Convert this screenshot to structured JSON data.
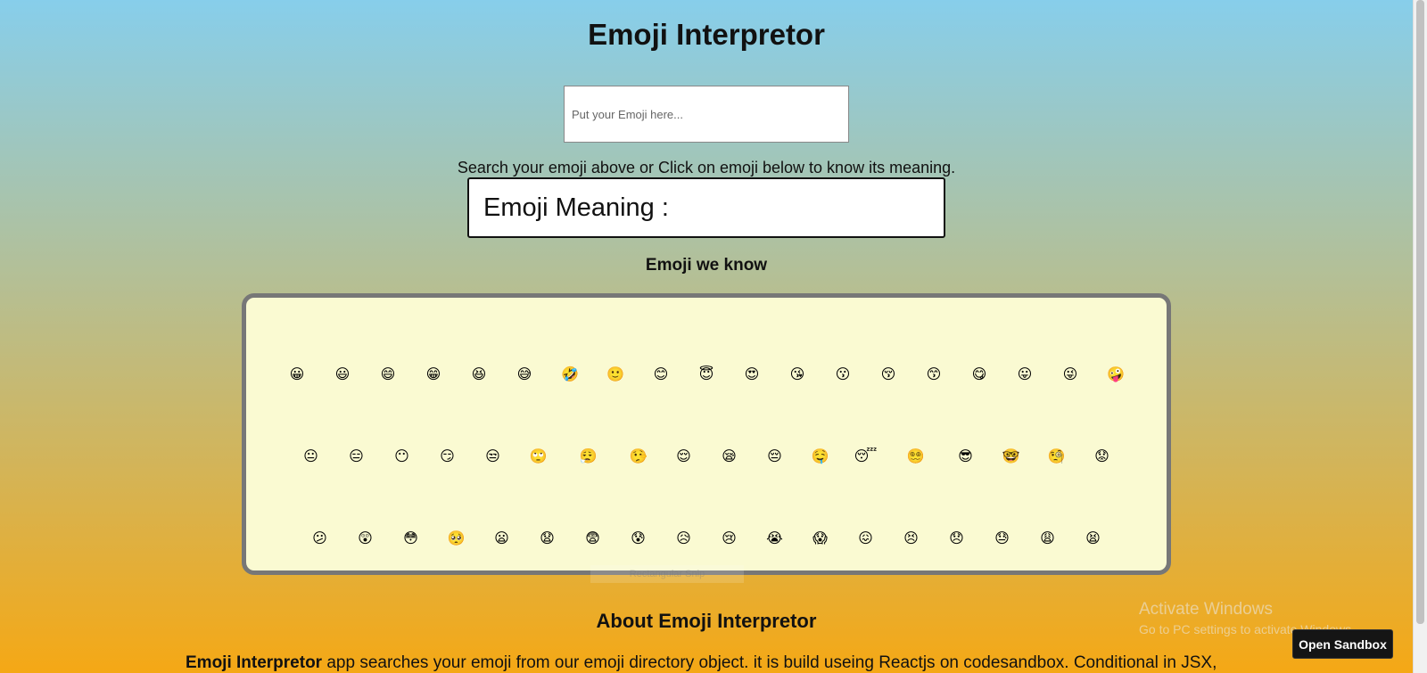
{
  "app": {
    "title": "Emoji Interpretor"
  },
  "search": {
    "placeholder": "Put your Emoji here...",
    "value": ""
  },
  "hint": "Search your emoji above or Click on emoji below to know its meaning.",
  "meaning": {
    "label": "Emoji Meaning :",
    "value": ""
  },
  "known": {
    "title": "Emoji we know",
    "rows": [
      [
        "😀",
        "😃",
        "😄",
        "😁",
        "😆",
        "😅",
        "🤣",
        "🙂",
        "😊",
        "😇",
        "😍",
        "😘",
        "😗",
        "😚",
        "😙",
        "😋",
        "😛",
        "😜",
        "🤪"
      ],
      [
        "😐",
        "😑",
        "😶",
        "😏",
        "😒",
        "🙄",
        "😮‍💨",
        "🤥",
        "😌",
        "😪",
        "😔",
        "🤤",
        "😴",
        "😵‍💫",
        "😎",
        "🤓",
        "🧐",
        "😟"
      ],
      [
        "😕",
        "😲",
        "😳",
        "🥺",
        "😦",
        "😧",
        "😨",
        "😰",
        "😥",
        "😢",
        "😭",
        "😱",
        "😖",
        "😣",
        "😞",
        "😓",
        "😩",
        "😫"
      ]
    ]
  },
  "overlay": {
    "ghost_label": "Rectangular Snip"
  },
  "about": {
    "title": "About Emoji Interpretor",
    "text_bold": "Emoji Interpretor",
    "text_rest": " app searches your emoji from our emoji directory object. it is build useing Reactjs on codesandbox. Conditional in JSX,"
  },
  "watermark": {
    "title": "Activate Windows",
    "subtitle": "Go to PC settings to activate Windows."
  },
  "sandbox": {
    "button_label": "Open Sandbox"
  }
}
